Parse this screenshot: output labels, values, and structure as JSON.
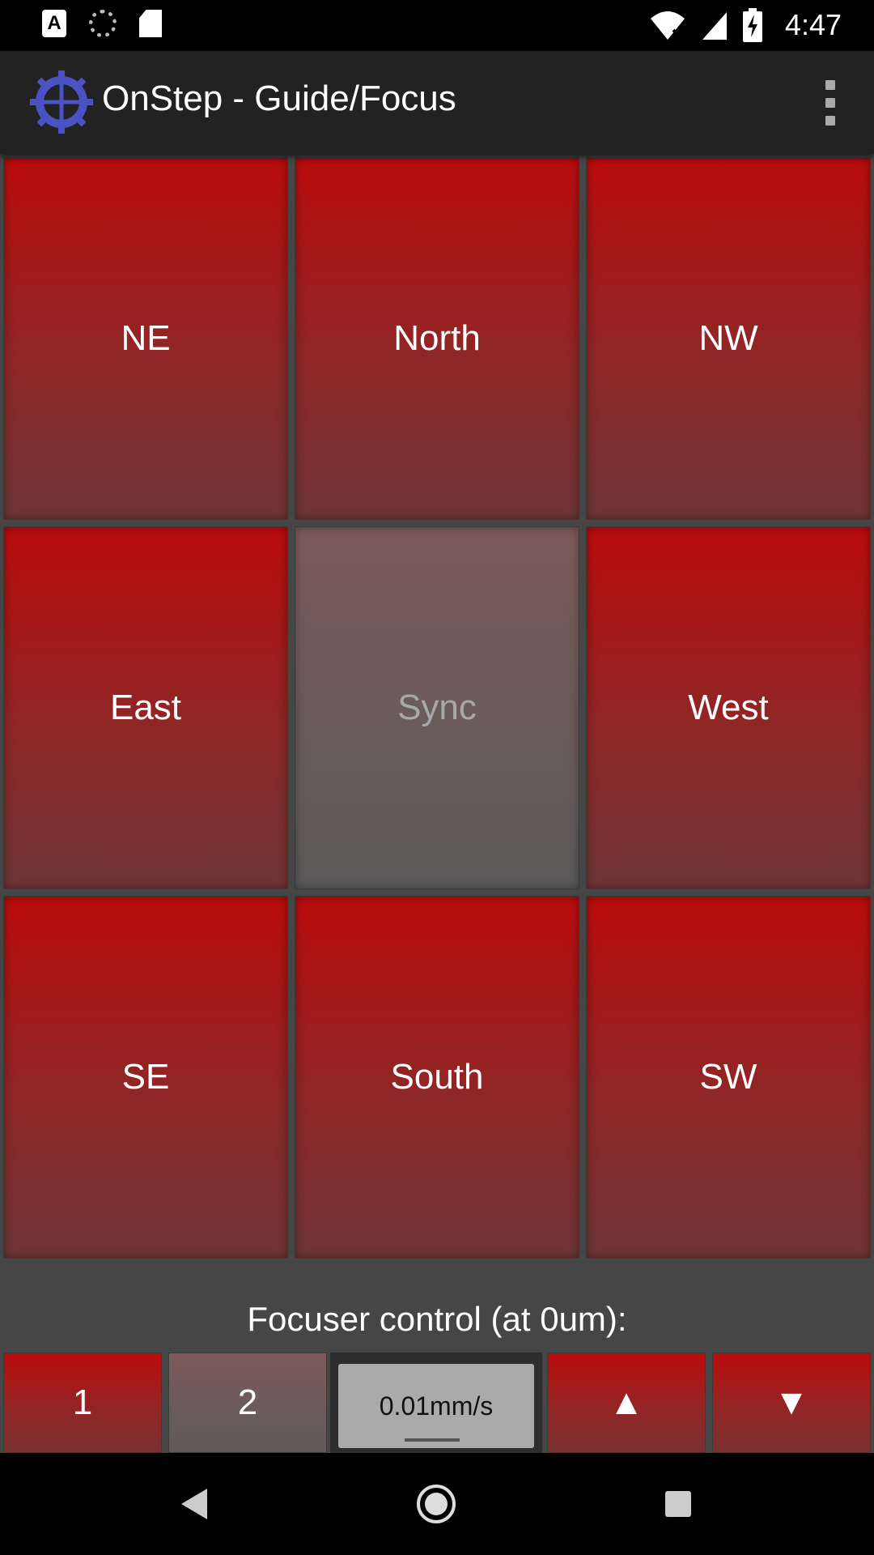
{
  "status_bar": {
    "time": "4:47",
    "icons": [
      "a-notification-icon",
      "sync-icon",
      "sd-card-icon",
      "wifi-icon",
      "signal-icon",
      "battery-charging-icon"
    ]
  },
  "app_bar": {
    "title": "OnStep - Guide/Focus",
    "logo_icon": "gear-crosshair-icon",
    "menu_icon": "overflow-menu-icon"
  },
  "direction_pad": {
    "ne": "NE",
    "north": "North",
    "nw": "NW",
    "east": "East",
    "sync": "Sync",
    "west": "West",
    "se": "SE",
    "south": "South",
    "sw": "SW"
  },
  "focuser": {
    "label": "Focuser control (at 0um):",
    "focuser1": "1",
    "focuser2": "2",
    "speed": "0.01mm/s",
    "up": "▲",
    "down": "▼"
  },
  "colors": {
    "button_red": "#bb0c0c",
    "button_disabled": "#7d5a5a",
    "app_bar": "#222222",
    "logo_blue": "#4a52c4"
  }
}
